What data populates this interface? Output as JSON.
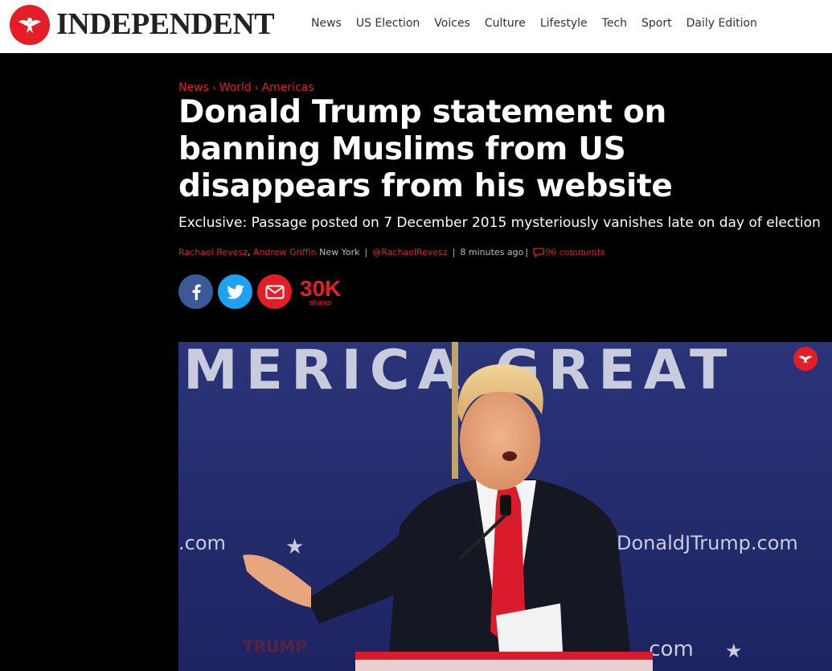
{
  "header": {
    "logo_text": "INDEPENDENT",
    "nav": [
      "News",
      "US Election",
      "Voices",
      "Culture",
      "Lifestyle",
      "Tech",
      "Sport",
      "Daily Edition"
    ]
  },
  "article": {
    "breadcrumb": [
      "News",
      "World",
      "Americas"
    ],
    "headline": "Donald Trump statement on banning Muslims from US disappears from his website",
    "standfirst": "Exclusive: Passage posted on 7 December 2015 mysteriously vanishes late on day of election",
    "byline": {
      "author1": "Rachael Revesz",
      "author_sep": ",",
      "author2": "Andrew Griffin",
      "location": "New York",
      "handle": "@RachaelRevesz",
      "time": "8 minutes  ago",
      "comments_count": "96",
      "comments_label": "comments"
    }
  },
  "share": {
    "count": "30K",
    "label": "shares"
  },
  "hero_image": {
    "banner_text": "MERICA GREAT",
    "sign_left": ".com",
    "sign_right": "DonaldJTrump.com",
    "sign_bottom": ".com",
    "podium_text": "TRUMP"
  },
  "colors": {
    "brand_red": "#e31e26",
    "facebook": "#3b5998",
    "twitter": "#1da1f2",
    "background": "#000000"
  }
}
